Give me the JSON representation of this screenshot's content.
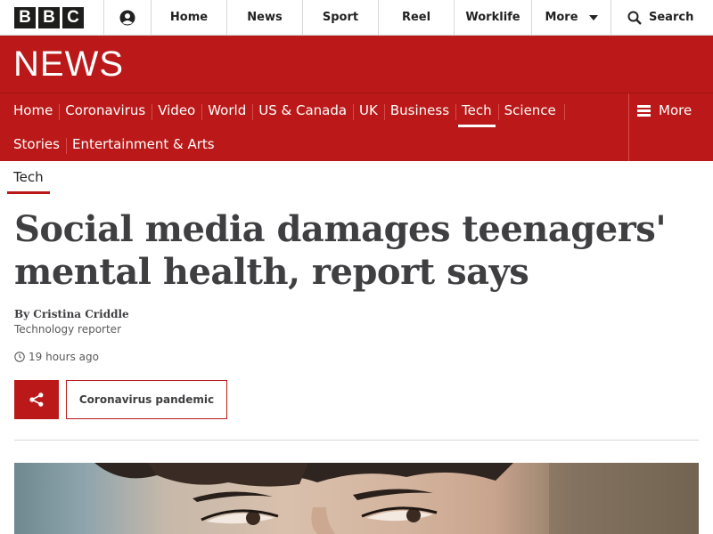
{
  "topbar": {
    "logo_letters": [
      "B",
      "B",
      "C"
    ],
    "nav": {
      "home": "Home",
      "news": "News",
      "sport": "Sport",
      "reel": "Reel",
      "worklife": "Worklife",
      "more": "More"
    },
    "search_label": "Search"
  },
  "news_header": {
    "logo": "NEWS"
  },
  "section_nav": {
    "row1": [
      "Home",
      "Coronavirus",
      "Video",
      "World",
      "US & Canada",
      "UK",
      "Business",
      "Tech",
      "Science"
    ],
    "row2": [
      "Stories",
      "Entertainment & Arts"
    ],
    "active": "Tech",
    "more_label": "More"
  },
  "article": {
    "section_tag": "Tech",
    "headline": "Social media damages teenagers' mental health, report says",
    "byline": "By Cristina Criddle",
    "author_role": "Technology reporter",
    "timestamp": "19 hours ago",
    "topic_tag": "Coronavirus pandemic"
  },
  "colors": {
    "brand_red": "#bb1919",
    "text_dark": "#3f3f42"
  },
  "icons": {
    "account": "account-icon",
    "search": "search-icon",
    "menu": "menu-icon",
    "clock": "clock-icon",
    "share": "share-icon"
  }
}
